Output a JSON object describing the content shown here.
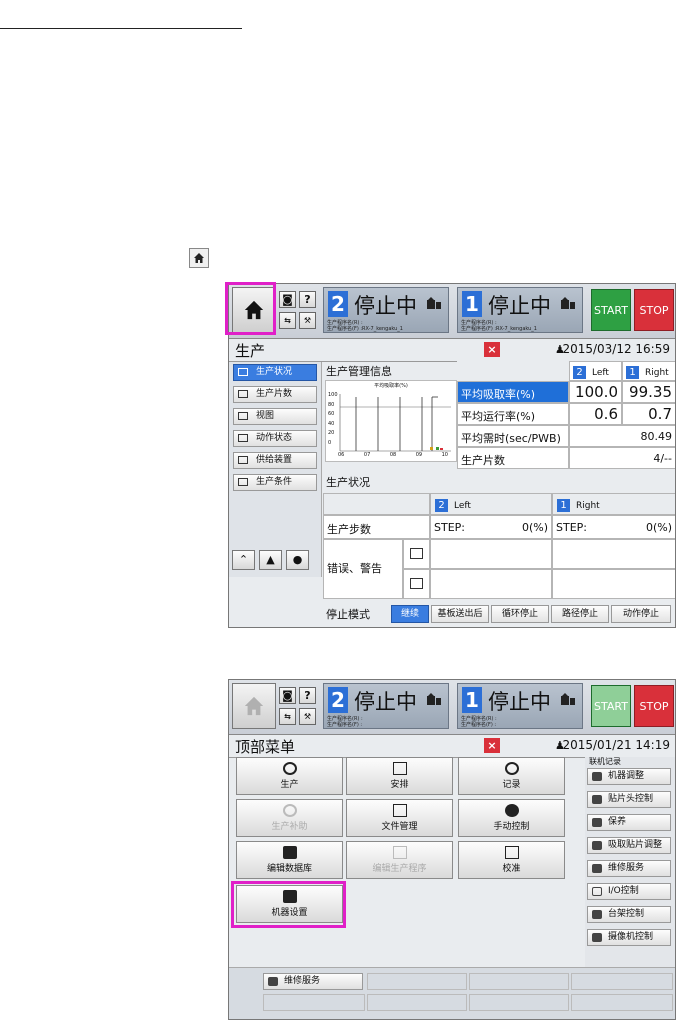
{
  "screen1": {
    "status_left": {
      "num": "2",
      "text": "停止中",
      "line1": "生产程序名(R) :",
      "line2": "生产程序名(F) :RX-7_kengaku_1"
    },
    "status_right": {
      "num": "1",
      "text": "停止中",
      "line1": "生产程序名(R) :",
      "line2": "生产程序名(F) :RX-7_kengaku_1"
    },
    "start_label": "START",
    "stop_label": "STOP",
    "title": "生产",
    "close": "×",
    "datetime": "2015/03/12 16:59",
    "nav": [
      "生产状况",
      "生产片数",
      "视图",
      "动作状态",
      "供给装置",
      "生产条件"
    ],
    "mgmt_title": "生产管理信息",
    "chart_title": "平均吸取率(%)",
    "chart_yticks": [
      "100",
      "80",
      "60",
      "40",
      "20",
      "0"
    ],
    "chart_xticks": [
      "06",
      "07",
      "08",
      "09",
      "10"
    ],
    "col_left": {
      "num": "2",
      "label": "Left"
    },
    "col_right": {
      "num": "1",
      "label": "Right"
    },
    "rows": [
      {
        "label": "平均吸取率(%)",
        "left": "100.0",
        "right": "99.35"
      },
      {
        "label": "平均运行率(%)",
        "left": "0.6",
        "right": "0.7"
      },
      {
        "label": "平均需时(sec/PWB)",
        "left": "",
        "right": "80.49"
      },
      {
        "label": "生产片数",
        "left": "",
        "right": "4/--"
      }
    ],
    "status_title": "生产状况",
    "step_label": "生产步数",
    "step_left_text": "STEP:",
    "step_left_val": "0(%)",
    "step_right_text": "STEP:",
    "step_right_val": "0(%)",
    "error_label": "错误、警告",
    "stop_mode_label": "停止模式",
    "stop_modes": [
      "继续",
      "基板送出后",
      "循环停止",
      "路径停止",
      "动作停止"
    ]
  },
  "screen2": {
    "status_left": {
      "num": "2",
      "text": "停止中",
      "line1": "生产程序名(R) :",
      "line2": "生产程序名(F) :"
    },
    "status_right": {
      "num": "1",
      "text": "停止中",
      "line1": "生产程序名(R) :",
      "line2": "生产程序名(F) :"
    },
    "start_label": "START",
    "stop_label": "STOP",
    "title": "顶部菜单",
    "close": "×",
    "datetime": "2015/01/21 14:19",
    "menu": [
      "生产",
      "安排",
      "记录",
      "生产补助",
      "文件管理",
      "手动控制",
      "编辑数据库",
      "编辑生产程序",
      "校准",
      "机器设置"
    ],
    "online_label": "联机记录",
    "side": [
      "机器调整",
      "贴片头控制",
      "保养",
      "吸取贴片调整",
      "维修服务",
      "I/O控制",
      "台架控制",
      "摄像机控制"
    ],
    "bottom_btn": "维修服务"
  }
}
